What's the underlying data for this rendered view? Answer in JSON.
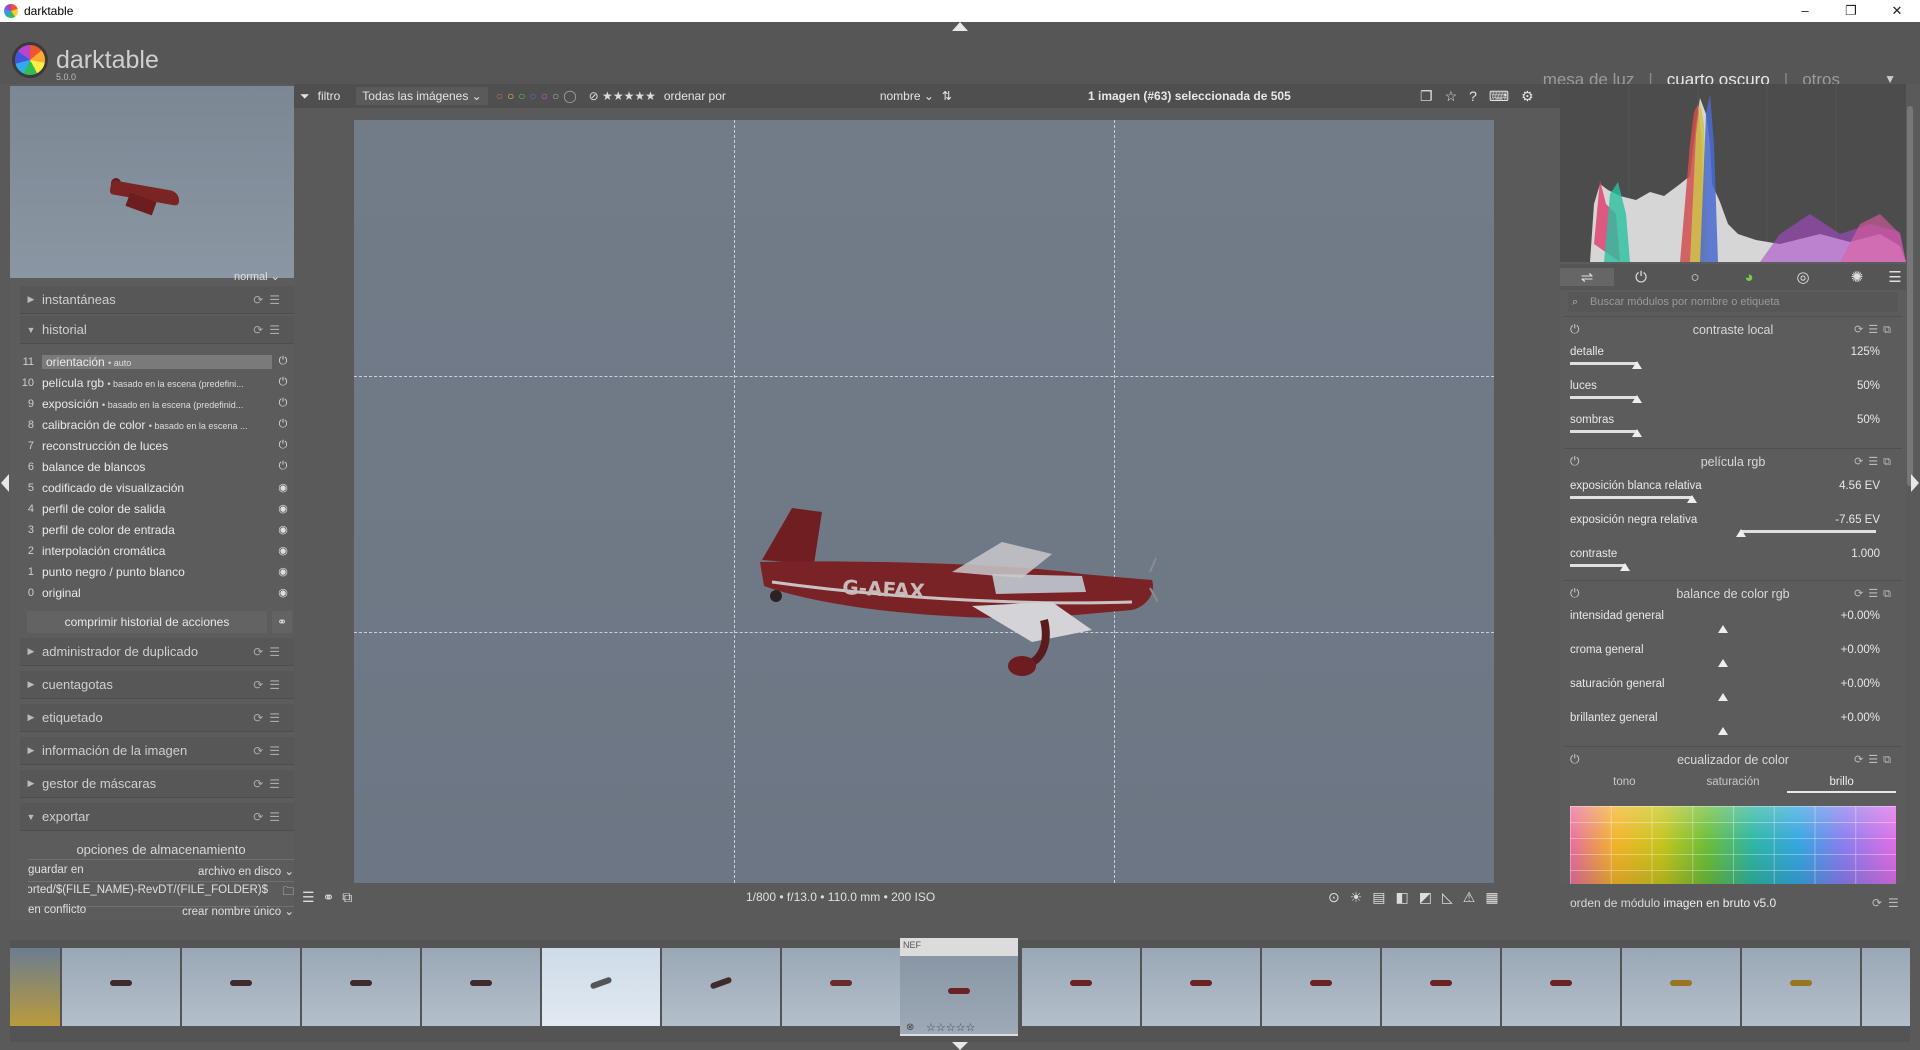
{
  "window": {
    "title": "darktable",
    "controls": [
      "–",
      "❐",
      "✕"
    ]
  },
  "app": {
    "name": "darktable",
    "version": "5.0.0"
  },
  "views": {
    "lighttable": "mesa de luz",
    "darkroom": "cuarto oscuro",
    "other": "otros",
    "separator": "|"
  },
  "left": {
    "zoom_label": "normal",
    "modules": {
      "snapshots": "instantáneas",
      "history": "historial",
      "duplicate": "administrador de duplicado",
      "colorpicker": "cuentagotas",
      "tagging": "etiquetado",
      "image_info": "información de la imagen",
      "mask_manager": "gestor de máscaras",
      "export": "exportar"
    },
    "history": [
      {
        "num": "11",
        "label": "orientación",
        "detail": "• auto"
      },
      {
        "num": "10",
        "label": "película rgb",
        "detail": "• basado en la escena (predefini..."
      },
      {
        "num": "9",
        "label": "exposición",
        "detail": "• basado en la escena (predefinid..."
      },
      {
        "num": "8",
        "label": "calibración de color",
        "detail": "• basado en la escena ..."
      },
      {
        "num": "7",
        "label": "reconstrucción de luces",
        "detail": ""
      },
      {
        "num": "6",
        "label": "balance de blancos",
        "detail": ""
      },
      {
        "num": "5",
        "label": "codificado de visualización",
        "detail": ""
      },
      {
        "num": "4",
        "label": "perfil de color de salida",
        "detail": ""
      },
      {
        "num": "3",
        "label": "perfil de color de entrada",
        "detail": ""
      },
      {
        "num": "2",
        "label": "interpolación cromática",
        "detail": ""
      },
      {
        "num": "1",
        "label": "punto negro / punto blanco",
        "detail": ""
      },
      {
        "num": "0",
        "label": "original",
        "detail": ""
      }
    ],
    "compress_label": "comprimir historial de acciones",
    "storage": {
      "title": "opciones de almacenamiento",
      "target_label": "guardar en",
      "target_value": "archivo en disco",
      "path": "$(FILE_FOLDER)/darktable_exported/$(FILE_NAME)-RevDT",
      "conflict_label": "en conflicto",
      "conflict_value": "crear nombre único"
    }
  },
  "filterbar": {
    "filter_label": "filtro",
    "collection": "Todas las imágenes",
    "sort_label": "ordenar por",
    "sort_value": "nombre",
    "selection_info": "1 imagen (#63) seleccionada de 505"
  },
  "exif": "1/800 • f/13.0 • 110.0 mm • 200 ISO",
  "right": {
    "search_placeholder": "Buscar módulos por nombre o etiqueta",
    "local_contrast": {
      "title": "contraste local",
      "sliders": [
        {
          "name": "detalle",
          "value": "125%",
          "pos": 0.22
        },
        {
          "name": "luces",
          "value": "50%",
          "pos": 0.22
        },
        {
          "name": "sombras",
          "value": "50%",
          "pos": 0.22
        }
      ]
    },
    "filmic": {
      "title": "película rgb",
      "sliders": [
        {
          "name": "exposición blanca relativa",
          "value": "4.56 EV",
          "pos": 0.4
        },
        {
          "name": "exposición negra relativa",
          "value": "-7.65 EV",
          "pos": 0.56
        },
        {
          "name": "contraste",
          "value": "1.000",
          "pos": 0.18
        }
      ]
    },
    "color_balance": {
      "title": "balance de color rgb",
      "sliders": [
        {
          "name": "intensidad general",
          "value": "+0.00%",
          "pos": 0.5
        },
        {
          "name": "croma general",
          "value": "+0.00%",
          "pos": 0.5
        },
        {
          "name": "saturación general",
          "value": "+0.00%",
          "pos": 0.5
        },
        {
          "name": "brillantez general",
          "value": "+0.00%",
          "pos": 0.5
        }
      ]
    },
    "color_eq": {
      "title": "ecualizador de color",
      "tabs": [
        "tono",
        "saturación",
        "brillo"
      ],
      "active_tab": "brillo"
    },
    "module_order_label": "orden de módulo",
    "module_order_value": "imagen en bruto v5.0"
  },
  "filmstrip": {
    "selected_badge": "NEF",
    "selected_stars": "☆☆☆☆☆"
  }
}
